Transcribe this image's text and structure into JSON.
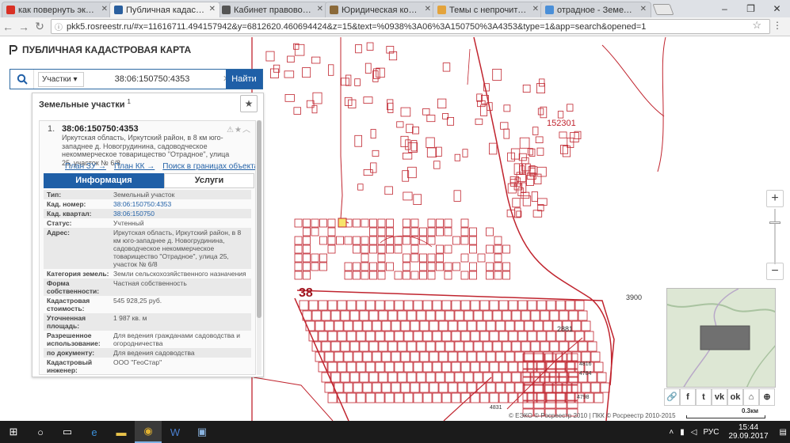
{
  "browser": {
    "tabs": [
      {
        "title": "как повернуть экран н",
        "color": "#d93025"
      },
      {
        "title": "Публичная кадастровая",
        "color": "#2a5f9e",
        "active": true
      },
      {
        "title": "Кабинет правовой зап",
        "color": "#555555"
      },
      {
        "title": "Юридическая консуль",
        "color": "#8b6a3a"
      },
      {
        "title": "Темы с непрочитанны",
        "color": "#e3a33b"
      },
      {
        "title": "отрадное - Земельны",
        "color": "#4a8fd8"
      }
    ],
    "url": "pkk5.rosreestr.ru/#x=11616711.494157942&y=6812620.460694424&z=15&text=%0938%3A06%3A150750%3A4353&type=1&app=search&opened=1"
  },
  "app": {
    "title": "ПУБЛИЧНАЯ КАДАСТРОВАЯ КАРТА",
    "search": {
      "category": "Участки",
      "query": "38:06:150750:4353",
      "button": "Найти"
    }
  },
  "panel": {
    "title": "Земельные участки",
    "count": "1",
    "item": {
      "num": "1.",
      "cad_number": "38:06:150750:4353",
      "address": "Иркутская область, Иркутский район, в 8 км юго-западнее д. Новогрудинина, садоводческое некоммерческое товарищество \"Отрадное\", улица 25, участок № 6/8",
      "links": [
        "План ЗУ →",
        "План КК →",
        "Поиск в границах объекта →"
      ],
      "tabs": {
        "info": "Информация",
        "services": "Услуги"
      },
      "rows": [
        {
          "k": "Тип:",
          "v": "Земельный участок"
        },
        {
          "k": "Кад. номер:",
          "v": "38:06:150750:4353",
          "link": true
        },
        {
          "k": "Кад. квартал:",
          "v": "38:06:150750",
          "link": true
        },
        {
          "k": "Статус:",
          "v": "Учтенный"
        },
        {
          "k": "Адрес:",
          "v": "Иркутская область, Иркутский район, в 8 км юго-западнее д. Новогрудинина, садоводческое некоммерческое товарищество \"Отрадное\", улица 25, участок № 6/8"
        },
        {
          "k": "Категория земель:",
          "v": "Земли сельскохозяйственного назначения"
        },
        {
          "k": "Форма собственности:",
          "v": "Частная собственность"
        },
        {
          "k": "Кадастровая стоимость:",
          "v": "545 928,25 руб."
        },
        {
          "k": "Уточненная площадь:",
          "v": "1 987 кв. м"
        },
        {
          "k": "Разрешенное использование:",
          "v": "Для ведения гражданами садоводства и огородничества"
        },
        {
          "k": "по документу:",
          "v": "Для ведения садоводства"
        },
        {
          "k": "Кадастровый инженер:",
          "v": "ООО \"ГеоСтар\""
        }
      ]
    }
  },
  "map": {
    "labels": [
      {
        "text": "152301",
        "big": false
      },
      {
        "text": "38",
        "big": true
      },
      {
        "text": "3900",
        "big": false
      },
      {
        "text": "2881",
        "big": false
      },
      {
        "text": "4816",
        "big": false
      },
      {
        "text": "4784",
        "big": false
      },
      {
        "text": "4798",
        "big": false
      },
      {
        "text": "4831",
        "big": false
      }
    ],
    "copyright": "© ЕЭКО © Росреестр 2010 | ПКК © Росреестр 2010-2015",
    "scale": "0.3км",
    "zoom": {
      "in": "+",
      "out": "−"
    },
    "share_icons": [
      "link-icon",
      "facebook-icon",
      "twitter-icon",
      "vk-icon",
      "ok-icon",
      "home-icon",
      "locate-icon",
      "fullscreen-icon"
    ]
  },
  "taskbar": {
    "lang": "РУС",
    "time": "15:44",
    "date": "29.09.2017"
  },
  "colors": {
    "accent": "#1f5fa7",
    "parcel": "#c0242e",
    "selected": "#f7e46a"
  }
}
